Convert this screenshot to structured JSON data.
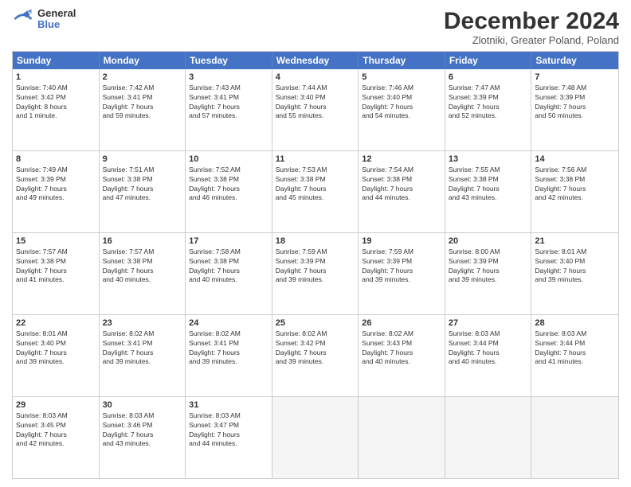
{
  "header": {
    "logo_general": "General",
    "logo_blue": "Blue",
    "month_title": "December 2024",
    "subtitle": "Zlotniki, Greater Poland, Poland"
  },
  "days_of_week": [
    "Sunday",
    "Monday",
    "Tuesday",
    "Wednesday",
    "Thursday",
    "Friday",
    "Saturday"
  ],
  "rows": [
    [
      {
        "day": "1",
        "info": "Sunrise: 7:40 AM\nSunset: 3:42 PM\nDaylight: 8 hours\nand 1 minute."
      },
      {
        "day": "2",
        "info": "Sunrise: 7:42 AM\nSunset: 3:41 PM\nDaylight: 7 hours\nand 59 minutes."
      },
      {
        "day": "3",
        "info": "Sunrise: 7:43 AM\nSunset: 3:41 PM\nDaylight: 7 hours\nand 57 minutes."
      },
      {
        "day": "4",
        "info": "Sunrise: 7:44 AM\nSunset: 3:40 PM\nDaylight: 7 hours\nand 55 minutes."
      },
      {
        "day": "5",
        "info": "Sunrise: 7:46 AM\nSunset: 3:40 PM\nDaylight: 7 hours\nand 54 minutes."
      },
      {
        "day": "6",
        "info": "Sunrise: 7:47 AM\nSunset: 3:39 PM\nDaylight: 7 hours\nand 52 minutes."
      },
      {
        "day": "7",
        "info": "Sunrise: 7:48 AM\nSunset: 3:39 PM\nDaylight: 7 hours\nand 50 minutes."
      }
    ],
    [
      {
        "day": "8",
        "info": "Sunrise: 7:49 AM\nSunset: 3:39 PM\nDaylight: 7 hours\nand 49 minutes."
      },
      {
        "day": "9",
        "info": "Sunrise: 7:51 AM\nSunset: 3:38 PM\nDaylight: 7 hours\nand 47 minutes."
      },
      {
        "day": "10",
        "info": "Sunrise: 7:52 AM\nSunset: 3:38 PM\nDaylight: 7 hours\nand 46 minutes."
      },
      {
        "day": "11",
        "info": "Sunrise: 7:53 AM\nSunset: 3:38 PM\nDaylight: 7 hours\nand 45 minutes."
      },
      {
        "day": "12",
        "info": "Sunrise: 7:54 AM\nSunset: 3:38 PM\nDaylight: 7 hours\nand 44 minutes."
      },
      {
        "day": "13",
        "info": "Sunrise: 7:55 AM\nSunset: 3:38 PM\nDaylight: 7 hours\nand 43 minutes."
      },
      {
        "day": "14",
        "info": "Sunrise: 7:56 AM\nSunset: 3:38 PM\nDaylight: 7 hours\nand 42 minutes."
      }
    ],
    [
      {
        "day": "15",
        "info": "Sunrise: 7:57 AM\nSunset: 3:38 PM\nDaylight: 7 hours\nand 41 minutes."
      },
      {
        "day": "16",
        "info": "Sunrise: 7:57 AM\nSunset: 3:38 PM\nDaylight: 7 hours\nand 40 minutes."
      },
      {
        "day": "17",
        "info": "Sunrise: 7:58 AM\nSunset: 3:38 PM\nDaylight: 7 hours\nand 40 minutes."
      },
      {
        "day": "18",
        "info": "Sunrise: 7:59 AM\nSunset: 3:39 PM\nDaylight: 7 hours\nand 39 minutes."
      },
      {
        "day": "19",
        "info": "Sunrise: 7:59 AM\nSunset: 3:39 PM\nDaylight: 7 hours\nand 39 minutes."
      },
      {
        "day": "20",
        "info": "Sunrise: 8:00 AM\nSunset: 3:39 PM\nDaylight: 7 hours\nand 39 minutes."
      },
      {
        "day": "21",
        "info": "Sunrise: 8:01 AM\nSunset: 3:40 PM\nDaylight: 7 hours\nand 39 minutes."
      }
    ],
    [
      {
        "day": "22",
        "info": "Sunrise: 8:01 AM\nSunset: 3:40 PM\nDaylight: 7 hours\nand 39 minutes."
      },
      {
        "day": "23",
        "info": "Sunrise: 8:02 AM\nSunset: 3:41 PM\nDaylight: 7 hours\nand 39 minutes."
      },
      {
        "day": "24",
        "info": "Sunrise: 8:02 AM\nSunset: 3:41 PM\nDaylight: 7 hours\nand 39 minutes."
      },
      {
        "day": "25",
        "info": "Sunrise: 8:02 AM\nSunset: 3:42 PM\nDaylight: 7 hours\nand 39 minutes."
      },
      {
        "day": "26",
        "info": "Sunrise: 8:02 AM\nSunset: 3:43 PM\nDaylight: 7 hours\nand 40 minutes."
      },
      {
        "day": "27",
        "info": "Sunrise: 8:03 AM\nSunset: 3:44 PM\nDaylight: 7 hours\nand 40 minutes."
      },
      {
        "day": "28",
        "info": "Sunrise: 8:03 AM\nSunset: 3:44 PM\nDaylight: 7 hours\nand 41 minutes."
      }
    ],
    [
      {
        "day": "29",
        "info": "Sunrise: 8:03 AM\nSunset: 3:45 PM\nDaylight: 7 hours\nand 42 minutes."
      },
      {
        "day": "30",
        "info": "Sunrise: 8:03 AM\nSunset: 3:46 PM\nDaylight: 7 hours\nand 43 minutes."
      },
      {
        "day": "31",
        "info": "Sunrise: 8:03 AM\nSunset: 3:47 PM\nDaylight: 7 hours\nand 44 minutes."
      },
      {
        "day": "",
        "info": ""
      },
      {
        "day": "",
        "info": ""
      },
      {
        "day": "",
        "info": ""
      },
      {
        "day": "",
        "info": ""
      }
    ]
  ]
}
